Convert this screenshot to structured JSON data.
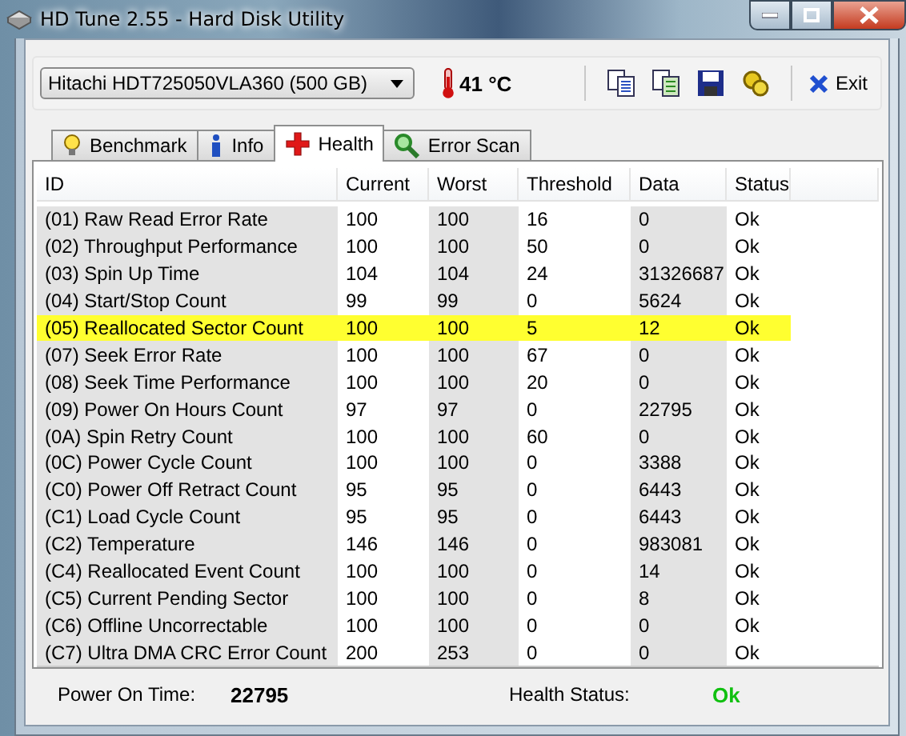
{
  "window": {
    "title": "HD Tune 2.55 - Hard Disk Utility"
  },
  "toolbar": {
    "drive": "Hitachi HDT725050VLA360 (500 GB)",
    "temperature": "41 °C",
    "exit_label": "Exit"
  },
  "tabs": [
    {
      "label": "Benchmark",
      "selected": false
    },
    {
      "label": "Info",
      "selected": false
    },
    {
      "label": "Health",
      "selected": true
    },
    {
      "label": "Error Scan",
      "selected": false
    }
  ],
  "table": {
    "columns": [
      "ID",
      "Current",
      "Worst",
      "Threshold",
      "Data",
      "Status"
    ],
    "rows": [
      {
        "cells": [
          "(01) Raw Read Error Rate",
          "100",
          "100",
          "16",
          "0",
          "Ok"
        ],
        "selected": false
      },
      {
        "cells": [
          "(02) Throughput Performance",
          "100",
          "100",
          "50",
          "0",
          "Ok"
        ],
        "selected": false
      },
      {
        "cells": [
          "(03) Spin Up Time",
          "104",
          "104",
          "24",
          "31326687",
          "Ok"
        ],
        "selected": false
      },
      {
        "cells": [
          "(04) Start/Stop Count",
          "99",
          "99",
          "0",
          "5624",
          "Ok"
        ],
        "selected": false
      },
      {
        "cells": [
          "(05) Reallocated Sector Count",
          "100",
          "100",
          "5",
          "12",
          "Ok"
        ],
        "selected": true
      },
      {
        "cells": [
          "(07) Seek Error Rate",
          "100",
          "100",
          "67",
          "0",
          "Ok"
        ],
        "selected": false
      },
      {
        "cells": [
          "(08) Seek Time Performance",
          "100",
          "100",
          "20",
          "0",
          "Ok"
        ],
        "selected": false
      },
      {
        "cells": [
          "(09) Power On Hours Count",
          "97",
          "97",
          "0",
          "22795",
          "Ok"
        ],
        "selected": false
      },
      {
        "cells": [
          "(0A) Spin Retry Count",
          "100",
          "100",
          "60",
          "0",
          "Ok"
        ],
        "selected": false
      },
      {
        "cells": [
          "(0C) Power Cycle Count",
          "100",
          "100",
          "0",
          "3388",
          "Ok"
        ],
        "selected": false
      },
      {
        "cells": [
          "(C0) Power Off Retract Count",
          "95",
          "95",
          "0",
          "6443",
          "Ok"
        ],
        "selected": false
      },
      {
        "cells": [
          "(C1) Load Cycle Count",
          "95",
          "95",
          "0",
          "6443",
          "Ok"
        ],
        "selected": false
      },
      {
        "cells": [
          "(C2) Temperature",
          "146",
          "146",
          "0",
          "983081",
          "Ok"
        ],
        "selected": false
      },
      {
        "cells": [
          "(C4) Reallocated Event Count",
          "100",
          "100",
          "0",
          "14",
          "Ok"
        ],
        "selected": false
      },
      {
        "cells": [
          "(C5) Current Pending Sector",
          "100",
          "100",
          "0",
          "8",
          "Ok"
        ],
        "selected": false
      },
      {
        "cells": [
          "(C6) Offline Uncorrectable",
          "100",
          "100",
          "0",
          "0",
          "Ok"
        ],
        "selected": false
      },
      {
        "cells": [
          "(C7) Ultra DMA CRC Error Count",
          "200",
          "253",
          "0",
          "0",
          "Ok"
        ],
        "selected": false
      }
    ]
  },
  "footer": {
    "power_on_label": "Power On Time:",
    "power_on_value": "22795",
    "health_label": "Health Status:",
    "health_value": "Ok"
  }
}
